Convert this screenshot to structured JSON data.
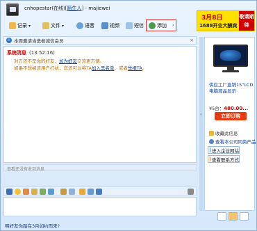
{
  "window": {
    "title_prefix": "cnhopestar(在线)[",
    "title_link": "陌生人",
    "title_suffix": "] - majiewei"
  },
  "ad": {
    "line1": "3月8日",
    "line2": "1688开业大酬宾",
    "side": "敬请期待"
  },
  "toolbar": {
    "record": "记录",
    "file": "文件",
    "voice": "语音",
    "video": "视频",
    "sms": "短信",
    "add": "添加"
  },
  "notice": {
    "text": "本周邀请当选者诚信会员"
  },
  "chat": {
    "sys_name": "系统消息",
    "sys_time": "(13:52:16)",
    "line1_a": "对方还不是你的好友，",
    "line1_link": "加为好友",
    "line1_b": "交流更方便。",
    "line2_a": "如果不想被该用户打扰，您还可以将TA",
    "line2_link1": "加入黑名单",
    "line2_b": "，或者",
    "line2_link2": "举报TA",
    "line2_c": "。"
  },
  "history": {
    "text": "查看还没有收到消息"
  },
  "footer": {
    "text": "明好友你踏在3月如约而来?"
  },
  "product": {
    "desc": "供应工厂直销15\"LCD电脑液晶显示",
    "price_label": "¥5台：",
    "price_value": "480.00...",
    "order": "立即订购"
  },
  "links": {
    "favorite": "收藏此信息",
    "more": "查看本公司同类产品",
    "enter_shop": "进入企业网站",
    "contact": "查看联系方式"
  },
  "colors": {
    "accent": "#2f7bd8",
    "ad_bg": "#ffe100",
    "order_btn": "#e63a10"
  }
}
